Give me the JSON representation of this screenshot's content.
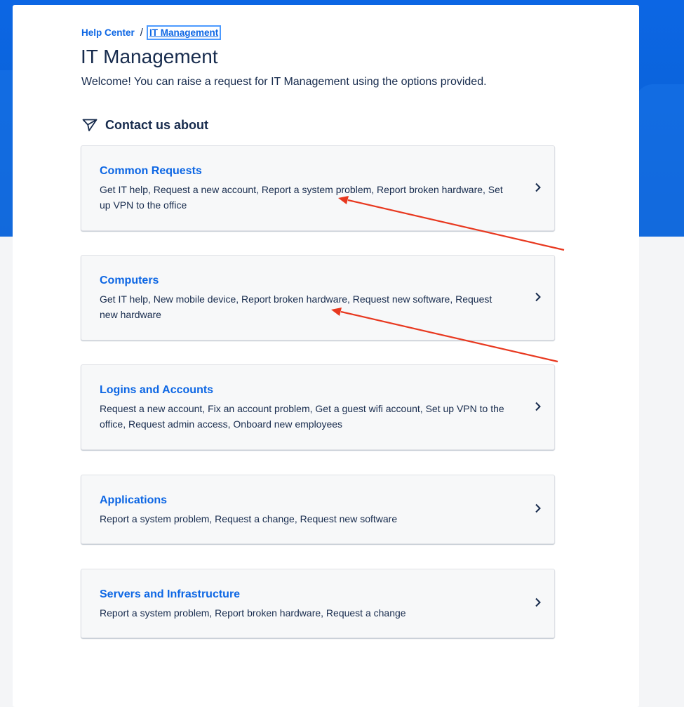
{
  "breadcrumb": {
    "home": "Help Center",
    "separator": "/",
    "current": "IT Management"
  },
  "page": {
    "title": "IT Management",
    "welcome": "Welcome! You can raise a request for IT Management using the options provided.",
    "contact_heading": "Contact us about"
  },
  "request_groups": [
    {
      "title": "Common Requests",
      "description": "Get IT help, Request a new account, Report a system problem, Report broken hardware, Set up VPN to the office"
    },
    {
      "title": "Computers",
      "description": "Get IT help, New mobile device, Report broken hardware, Request new software, Request new hardware"
    },
    {
      "title": "Logins and Accounts",
      "description": "Request a new account, Fix an account problem, Get a guest wifi account, Set up VPN to the office, Request admin access, Onboard new employees"
    },
    {
      "title": "Applications",
      "description": "Report a system problem, Request a change, Request new software"
    },
    {
      "title": "Servers and Infrastructure",
      "description": "Report a system problem, Report broken hardware, Request a change"
    }
  ],
  "icons": {
    "contact": "send-icon",
    "card_arrow": "chevron-right-icon"
  },
  "colors": {
    "banner": "#0c66e4",
    "link": "#0c66e4",
    "text": "#172b4d",
    "annotation_arrow": "#e8381f"
  }
}
